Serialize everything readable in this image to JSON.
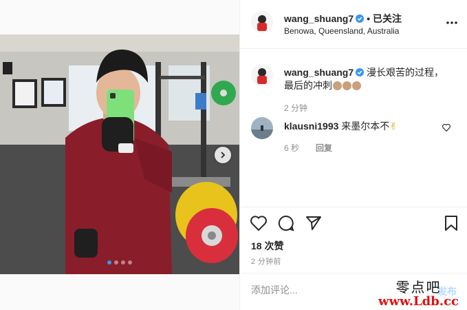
{
  "post": {
    "slide_count": 4,
    "active_slide": 1
  },
  "header": {
    "username": "wang_shuang7",
    "separator": "•",
    "follow_status": "已关注",
    "location": "Benowa, Queensland, Australia",
    "avatar_icon": "avatar-icon",
    "verified_icon": "verified-icon",
    "more_icon": "more-options-icon"
  },
  "caption": {
    "username": "wang_shuang7",
    "text_line1": "漫长艰苦的过程，",
    "text_line2": "最后的冲刺",
    "emoji_count": 3,
    "time": "2 分钟"
  },
  "comments": [
    {
      "username": "klausni1993",
      "text": "来墨尔本不",
      "emoji": "✌",
      "time": "6 秒",
      "reply_label": "回复"
    }
  ],
  "actions": {
    "like_icon": "heart-icon",
    "comment_icon": "comment-icon",
    "share_icon": "share-icon",
    "save_icon": "bookmark-icon",
    "likes": "18 次赞",
    "date": "2 分钟前"
  },
  "add_comment": {
    "placeholder": "添加评论...",
    "post_label": "发布"
  },
  "watermark": {
    "title": "零点吧",
    "url": "www.Ldb.cc"
  },
  "colors": {
    "accent": "#3897f0",
    "post_disabled": "#b3dbff",
    "border": "#efefef",
    "muted": "#8e8e8e"
  }
}
